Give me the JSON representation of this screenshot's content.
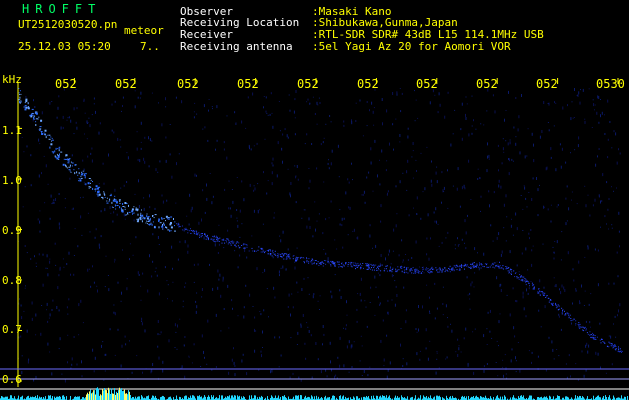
{
  "app": {
    "title": "HROFFT",
    "filename": "UT2512030520.pn",
    "suffix": "meteor",
    "datetime": "25.12.03 05:20",
    "extra": "7.."
  },
  "info": {
    "labels": [
      "Observer",
      "Receiving Location",
      "Receiver",
      "Receiving antenna"
    ],
    "values": [
      ":Masaki Kano",
      ":Shibukawa,Gunma,Japan",
      ":RTL-SDR SDR# 43dB L15 114.1MHz USB",
      ":5el Yagi Az 20 for Aomori VOR"
    ]
  },
  "chart_data": {
    "type": "heatmap",
    "ylabel": "kHz",
    "y_ticks": [
      "1.1",
      "1.0",
      "0.9",
      "0.8",
      "0.7",
      "0.6"
    ],
    "x_ticks": [
      "052",
      "052",
      "052",
      "052",
      "052",
      "052",
      "052",
      "052",
      "052",
      "0530"
    ],
    "x_range": [
      0.0,
      10.0
    ],
    "ylim": [
      0.6,
      1.18
    ],
    "trace": {
      "x": [
        0.0,
        0.3,
        0.6,
        1.0,
        1.4,
        1.8,
        2.2,
        2.6,
        3.0,
        3.5,
        4.0,
        4.5,
        5.0,
        5.5,
        6.0,
        6.5,
        7.0,
        7.5,
        8.0,
        8.5,
        9.0,
        9.5,
        10.0
      ],
      "y": [
        1.17,
        1.12,
        1.06,
        1.01,
        0.97,
        0.94,
        0.92,
        0.91,
        0.89,
        0.875,
        0.86,
        0.845,
        0.835,
        0.83,
        0.825,
        0.82,
        0.82,
        0.83,
        0.83,
        0.79,
        0.74,
        0.69,
        0.66
      ]
    }
  }
}
